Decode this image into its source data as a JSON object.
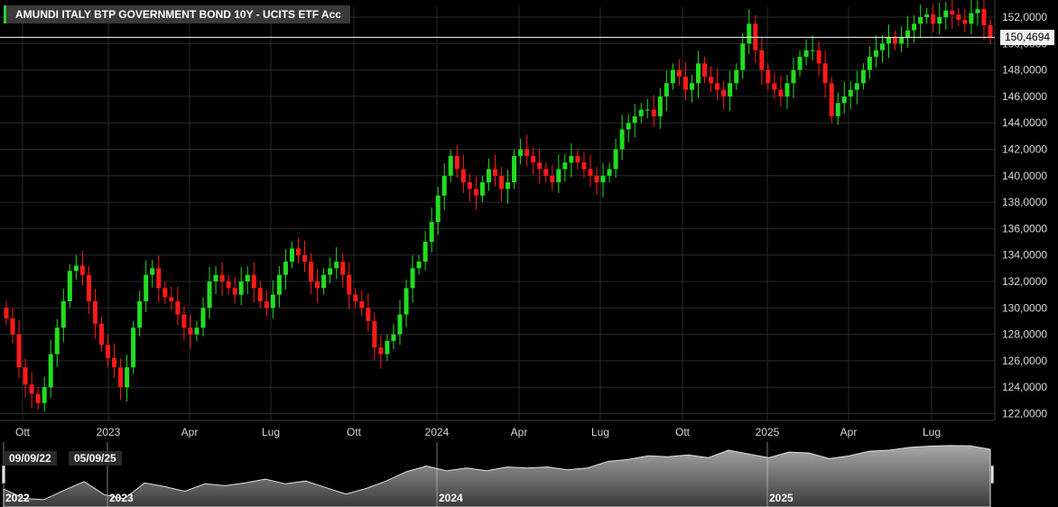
{
  "header": {
    "title": "AMUNDI ITALY BTP GOVERNMENT BOND 10Y - UCITS ETF Acc"
  },
  "last_price_label": "150,4694",
  "range_selector": {
    "start": "09/09/22",
    "end": "05/09/25"
  },
  "navigator_years": [
    "2022",
    "2023",
    "2024",
    "2025"
  ],
  "colors": {
    "up": "#22dd22",
    "down": "#ff1a1a",
    "background": "#000000",
    "grid": "#2a2a2a",
    "navigator_fill": "#8a8a8a"
  },
  "chart_data": {
    "type": "candlestick",
    "x_ticks": [
      "Ott",
      "2023",
      "Apr",
      "Lug",
      "Ott",
      "2024",
      "Apr",
      "Lug",
      "Ott",
      "2025",
      "Apr",
      "Lug"
    ],
    "y_ticks": [
      "122,0000",
      "124,0000",
      "126,0000",
      "128,0000",
      "130,0000",
      "132,0000",
      "134,0000",
      "136,0000",
      "138,0000",
      "140,0000",
      "142,0000",
      "144,0000",
      "146,0000",
      "148,0000",
      "150,0000",
      "152,0000"
    ],
    "ylim": [
      121.5,
      152.5
    ],
    "last_value": 150.4694,
    "weekly_close": [
      129.2,
      128.0,
      125.5,
      124.2,
      123.5,
      122.8,
      124.0,
      126.5,
      128.5,
      130.5,
      132.8,
      133.2,
      132.5,
      130.5,
      128.8,
      127.2,
      126.2,
      125.5,
      124.0,
      125.5,
      128.5,
      130.5,
      132.5,
      133.0,
      131.5,
      130.8,
      130.5,
      129.5,
      128.5,
      128.0,
      128.5,
      130.0,
      132.0,
      132.5,
      132.0,
      131.5,
      131.0,
      132.0,
      132.5,
      131.5,
      130.5,
      130.0,
      131.0,
      132.5,
      133.5,
      134.5,
      134.0,
      133.5,
      132.0,
      131.5,
      132.5,
      133.0,
      133.5,
      132.5,
      131.0,
      130.5,
      130.0,
      129.0,
      127.0,
      126.5,
      127.5,
      128.0,
      129.5,
      131.5,
      133.0,
      133.5,
      135.0,
      136.5,
      138.5,
      140.0,
      141.5,
      140.5,
      139.5,
      139.0,
      138.5,
      139.5,
      140.5,
      140.0,
      139.0,
      139.5,
      141.5,
      142.0,
      141.5,
      141.0,
      140.5,
      140.0,
      139.5,
      140.5,
      141.0,
      141.5,
      141.0,
      140.5,
      140.0,
      139.5,
      140.0,
      140.5,
      142.0,
      143.5,
      144.0,
      144.5,
      145.0,
      145.0,
      144.5,
      146.0,
      147.0,
      148.0,
      147.5,
      146.5,
      147.0,
      148.5,
      147.5,
      147.0,
      146.5,
      146.0,
      147.0,
      148.0,
      150.0,
      151.5,
      149.5,
      148.0,
      147.0,
      146.5,
      146.0,
      147.0,
      148.0,
      149.0,
      149.5,
      149.5,
      148.5,
      147.0,
      144.5,
      145.5,
      146.0,
      146.5,
      147.0,
      148.0,
      149.0,
      149.5,
      150.0,
      150.5,
      150.0,
      150.5,
      151.0,
      151.5,
      152.0,
      152.2,
      151.5,
      152.0,
      152.5,
      152.2,
      151.8,
      151.5,
      152.3,
      152.6,
      151.4,
      150.47
    ],
    "navigator_close": [
      129.2,
      124.2,
      123.5,
      128.5,
      133.2,
      126.2,
      124.0,
      132.5,
      130.5,
      128.0,
      132.0,
      131.0,
      132.5,
      134.5,
      132.0,
      133.5,
      130.0,
      126.5,
      129.5,
      133.5,
      138.5,
      141.5,
      139.0,
      140.5,
      139.0,
      141.0,
      140.5,
      141.0,
      139.5,
      140.5,
      144.0,
      145.0,
      147.0,
      146.5,
      147.5,
      146.0,
      150.0,
      148.0,
      146.0,
      149.0,
      148.5,
      145.5,
      147.0,
      149.5,
      150.0,
      151.5,
      152.2,
      152.5,
      152.3,
      150.47
    ]
  }
}
